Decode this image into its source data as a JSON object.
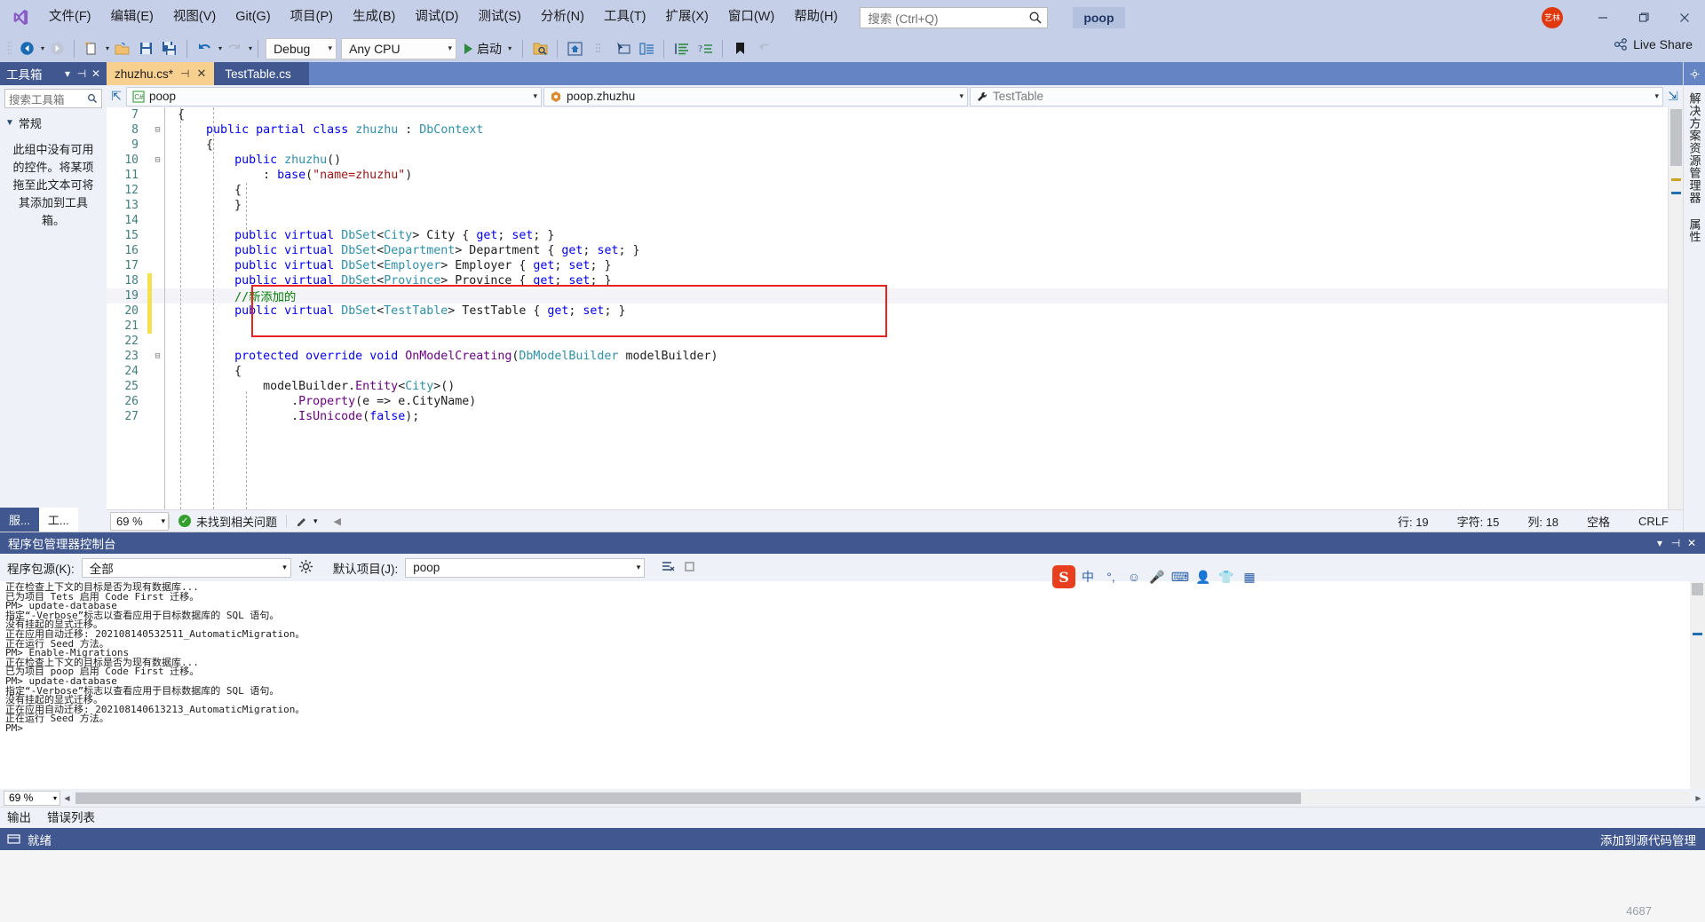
{
  "titlebar": {
    "menu": [
      {
        "label": "文件(F)",
        "key": "F"
      },
      {
        "label": "编辑(E)",
        "key": "E"
      },
      {
        "label": "视图(V)",
        "key": "V"
      },
      {
        "label": "Git(G)",
        "key": "G"
      },
      {
        "label": "项目(P)",
        "key": "P"
      },
      {
        "label": "生成(B)",
        "key": "B"
      },
      {
        "label": "调试(D)",
        "key": "D"
      },
      {
        "label": "测试(S)",
        "key": "S"
      },
      {
        "label": "分析(N)",
        "key": "N"
      },
      {
        "label": "工具(T)",
        "key": "T"
      },
      {
        "label": "扩展(X)",
        "key": "X"
      },
      {
        "label": "窗口(W)",
        "key": "W"
      },
      {
        "label": "帮助(H)",
        "key": "H"
      }
    ],
    "search_placeholder": "搜索 (Ctrl+Q)",
    "project_name": "poop",
    "account_initials": "艺林",
    "minimize": "—",
    "maximize": "❐",
    "close": "✕"
  },
  "toolbar": {
    "configuration": "Debug",
    "platform": "Any CPU",
    "run_label": "启动",
    "live_share": "Live Share"
  },
  "toolbox": {
    "title": "工具箱",
    "search_placeholder": "搜索工具箱",
    "group": "常规",
    "note": "此组中没有可用的控件。将某项拖至此文本可将其添加到工具箱。",
    "bottom_tabs": [
      "服...",
      "工..."
    ]
  },
  "tabs": [
    {
      "label": "zhuzhu.cs*",
      "active": true,
      "pin": "⊣",
      "close": "✕"
    },
    {
      "label": "TestTable.cs",
      "active": false,
      "pin": "",
      "close": ""
    }
  ],
  "navbar": {
    "project": "poop",
    "class": "poop.zhuzhu",
    "member": "TestTable"
  },
  "code": {
    "lines": [
      {
        "num": "7",
        "fold": "",
        "modified": false,
        "highlight": false,
        "tokens": [
          {
            "t": "  {",
            "c": "p"
          }
        ]
      },
      {
        "num": "8",
        "fold": "⊟",
        "modified": false,
        "highlight": false,
        "tokens": [
          {
            "t": "      ",
            "c": "p"
          },
          {
            "t": "public",
            "c": "k"
          },
          {
            "t": " ",
            "c": "p"
          },
          {
            "t": "partial",
            "c": "k"
          },
          {
            "t": " ",
            "c": "p"
          },
          {
            "t": "class",
            "c": "k"
          },
          {
            "t": " ",
            "c": "p"
          },
          {
            "t": "zhuzhu",
            "c": "t"
          },
          {
            "t": " : ",
            "c": "p"
          },
          {
            "t": "DbContext",
            "c": "t"
          }
        ]
      },
      {
        "num": "9",
        "fold": "",
        "modified": false,
        "highlight": false,
        "tokens": [
          {
            "t": "      {",
            "c": "p"
          }
        ]
      },
      {
        "num": "10",
        "fold": "⊟",
        "modified": false,
        "highlight": false,
        "tokens": [
          {
            "t": "          ",
            "c": "p"
          },
          {
            "t": "public",
            "c": "k"
          },
          {
            "t": " ",
            "c": "p"
          },
          {
            "t": "zhuzhu",
            "c": "t"
          },
          {
            "t": "()",
            "c": "p"
          }
        ]
      },
      {
        "num": "11",
        "fold": "",
        "modified": false,
        "highlight": false,
        "tokens": [
          {
            "t": "              : ",
            "c": "p"
          },
          {
            "t": "base",
            "c": "k"
          },
          {
            "t": "(",
            "c": "p"
          },
          {
            "t": "\"name=zhuzhu\"",
            "c": "s"
          },
          {
            "t": ")",
            "c": "p"
          }
        ]
      },
      {
        "num": "12",
        "fold": "",
        "modified": false,
        "highlight": false,
        "tokens": [
          {
            "t": "          {",
            "c": "p"
          }
        ]
      },
      {
        "num": "13",
        "fold": "",
        "modified": false,
        "highlight": false,
        "tokens": [
          {
            "t": "          }",
            "c": "p"
          }
        ]
      },
      {
        "num": "14",
        "fold": "",
        "modified": false,
        "highlight": false,
        "tokens": [
          {
            "t": "",
            "c": "p"
          }
        ]
      },
      {
        "num": "15",
        "fold": "",
        "modified": false,
        "highlight": false,
        "tokens": [
          {
            "t": "          ",
            "c": "p"
          },
          {
            "t": "public",
            "c": "k"
          },
          {
            "t": " ",
            "c": "p"
          },
          {
            "t": "virtual",
            "c": "k"
          },
          {
            "t": " ",
            "c": "p"
          },
          {
            "t": "DbSet",
            "c": "t"
          },
          {
            "t": "<",
            "c": "p"
          },
          {
            "t": "City",
            "c": "t"
          },
          {
            "t": "> City { ",
            "c": "p"
          },
          {
            "t": "get",
            "c": "k"
          },
          {
            "t": "; ",
            "c": "p"
          },
          {
            "t": "set",
            "c": "k"
          },
          {
            "t": "; }",
            "c": "p"
          }
        ]
      },
      {
        "num": "16",
        "fold": "",
        "modified": false,
        "highlight": false,
        "tokens": [
          {
            "t": "          ",
            "c": "p"
          },
          {
            "t": "public",
            "c": "k"
          },
          {
            "t": " ",
            "c": "p"
          },
          {
            "t": "virtual",
            "c": "k"
          },
          {
            "t": " ",
            "c": "p"
          },
          {
            "t": "DbSet",
            "c": "t"
          },
          {
            "t": "<",
            "c": "p"
          },
          {
            "t": "Department",
            "c": "t"
          },
          {
            "t": "> Department { ",
            "c": "p"
          },
          {
            "t": "get",
            "c": "k"
          },
          {
            "t": "; ",
            "c": "p"
          },
          {
            "t": "set",
            "c": "k"
          },
          {
            "t": "; }",
            "c": "p"
          }
        ]
      },
      {
        "num": "17",
        "fold": "",
        "modified": false,
        "highlight": false,
        "tokens": [
          {
            "t": "          ",
            "c": "p"
          },
          {
            "t": "public",
            "c": "k"
          },
          {
            "t": " ",
            "c": "p"
          },
          {
            "t": "virtual",
            "c": "k"
          },
          {
            "t": " ",
            "c": "p"
          },
          {
            "t": "DbSet",
            "c": "t"
          },
          {
            "t": "<",
            "c": "p"
          },
          {
            "t": "Employer",
            "c": "t"
          },
          {
            "t": "> Employer { ",
            "c": "p"
          },
          {
            "t": "get",
            "c": "k"
          },
          {
            "t": "; ",
            "c": "p"
          },
          {
            "t": "set",
            "c": "k"
          },
          {
            "t": "; }",
            "c": "p"
          }
        ]
      },
      {
        "num": "18",
        "fold": "",
        "modified": true,
        "highlight": false,
        "tokens": [
          {
            "t": "          ",
            "c": "p"
          },
          {
            "t": "public",
            "c": "k"
          },
          {
            "t": " ",
            "c": "p"
          },
          {
            "t": "virtual",
            "c": "k"
          },
          {
            "t": " ",
            "c": "p"
          },
          {
            "t": "DbSet",
            "c": "t"
          },
          {
            "t": "<",
            "c": "p"
          },
          {
            "t": "Province",
            "c": "t"
          },
          {
            "t": "> Province { ",
            "c": "p"
          },
          {
            "t": "get",
            "c": "k"
          },
          {
            "t": "; ",
            "c": "p"
          },
          {
            "t": "set",
            "c": "k"
          },
          {
            "t": "; }",
            "c": "p"
          }
        ]
      },
      {
        "num": "19",
        "fold": "",
        "modified": true,
        "highlight": true,
        "tokens": [
          {
            "t": "          ",
            "c": "p"
          },
          {
            "t": "//新添加的",
            "c": "c"
          }
        ]
      },
      {
        "num": "20",
        "fold": "",
        "modified": true,
        "highlight": false,
        "tokens": [
          {
            "t": "          ",
            "c": "p"
          },
          {
            "t": "public",
            "c": "k"
          },
          {
            "t": " ",
            "c": "p"
          },
          {
            "t": "virtual",
            "c": "k"
          },
          {
            "t": " ",
            "c": "p"
          },
          {
            "t": "DbSet",
            "c": "t"
          },
          {
            "t": "<",
            "c": "p"
          },
          {
            "t": "TestTable",
            "c": "t"
          },
          {
            "t": "> TestTable { ",
            "c": "p"
          },
          {
            "t": "get",
            "c": "k"
          },
          {
            "t": "; ",
            "c": "p"
          },
          {
            "t": "set",
            "c": "k"
          },
          {
            "t": "; }",
            "c": "p"
          }
        ]
      },
      {
        "num": "21",
        "fold": "",
        "modified": true,
        "highlight": false,
        "tokens": [
          {
            "t": "",
            "c": "p"
          }
        ]
      },
      {
        "num": "22",
        "fold": "",
        "modified": false,
        "highlight": false,
        "tokens": [
          {
            "t": "",
            "c": "p"
          }
        ]
      },
      {
        "num": "23",
        "fold": "⊟",
        "modified": false,
        "highlight": false,
        "tokens": [
          {
            "t": "          ",
            "c": "p"
          },
          {
            "t": "protected",
            "c": "k"
          },
          {
            "t": " ",
            "c": "p"
          },
          {
            "t": "override",
            "c": "k"
          },
          {
            "t": " ",
            "c": "p"
          },
          {
            "t": "void",
            "c": "k"
          },
          {
            "t": " ",
            "c": "p"
          },
          {
            "t": "OnModelCreating",
            "c": "m"
          },
          {
            "t": "(",
            "c": "p"
          },
          {
            "t": "DbModelBuilder",
            "c": "t"
          },
          {
            "t": " modelBuilder)",
            "c": "p"
          }
        ]
      },
      {
        "num": "24",
        "fold": "",
        "modified": false,
        "highlight": false,
        "tokens": [
          {
            "t": "          {",
            "c": "p"
          }
        ]
      },
      {
        "num": "25",
        "fold": "",
        "modified": false,
        "highlight": false,
        "tokens": [
          {
            "t": "              modelBuilder.",
            "c": "p"
          },
          {
            "t": "Entity",
            "c": "m"
          },
          {
            "t": "<",
            "c": "p"
          },
          {
            "t": "City",
            "c": "t"
          },
          {
            "t": ">()",
            "c": "p"
          }
        ]
      },
      {
        "num": "26",
        "fold": "",
        "modified": false,
        "highlight": false,
        "tokens": [
          {
            "t": "                  .",
            "c": "p"
          },
          {
            "t": "Property",
            "c": "m"
          },
          {
            "t": "(e => e.CityName)",
            "c": "p"
          }
        ]
      },
      {
        "num": "27",
        "fold": "",
        "modified": false,
        "highlight": false,
        "tokens": [
          {
            "t": "                  .",
            "c": "p"
          },
          {
            "t": "IsUnicode",
            "c": "m"
          },
          {
            "t": "(",
            "c": "p"
          },
          {
            "t": "false",
            "c": "k"
          },
          {
            "t": ");",
            "c": "p"
          }
        ]
      }
    ]
  },
  "editor_status": {
    "zoom": "69 %",
    "issues": "未找到相关问题",
    "line_label": "行: 19",
    "char_label": "字符: 15",
    "col_label": "列: 18",
    "spaces": "空格",
    "eol": "CRLF"
  },
  "right_dock": {
    "tabs": [
      "解决方案资源管理器",
      "属性"
    ]
  },
  "pmc": {
    "title": "程序包管理器控制台",
    "source_label": "程序包源(K):",
    "source_value": "全部",
    "default_project_label": "默认项目(J):",
    "default_project_value": "poop",
    "zoom": "69 %",
    "output": [
      "正在检查上下文的目标是否为现有数据库...",
      "已为项目 Tets 启用 Code First 迁移。",
      "PM> update-database",
      "指定“-Verbose”标志以查看应用于目标数据库的 SQL 语句。",
      "没有挂起的显式迁移。",
      "正在应用自动迁移: 202108140532511_AutomaticMigration。",
      "正在运行 Seed 方法。",
      "PM> Enable-Migrations",
      "正在检查上下文的目标是否为现有数据库...",
      "已为项目 poop 启用 Code First 迁移。",
      "PM> update-database",
      "指定“-Verbose”标志以查看应用于目标数据库的 SQL 语句。",
      "没有挂起的显式迁移。",
      "正在应用自动迁移: 202108140613213_AutomaticMigration。",
      "正在运行 Seed 方法。",
      "PM>"
    ]
  },
  "output_tabs": [
    "输出",
    "错误列表"
  ],
  "statusbar": {
    "ready": "就绪",
    "source_control": "添加到源代码管理",
    "counter": "4687"
  },
  "ime": {
    "logo": "S",
    "items": [
      "中",
      "°,",
      "☺",
      "🎤",
      "⌨",
      "👤",
      "👕",
      "▦"
    ]
  },
  "colors": {
    "titlebar": "#c5cfe8",
    "accent_blue": "#41578f",
    "tab_active": "#f7cf8e",
    "highlight_red": "#e8231f",
    "keyword": "#0000ff",
    "type": "#2b91af",
    "string": "#a31515",
    "comment": "#008000"
  }
}
